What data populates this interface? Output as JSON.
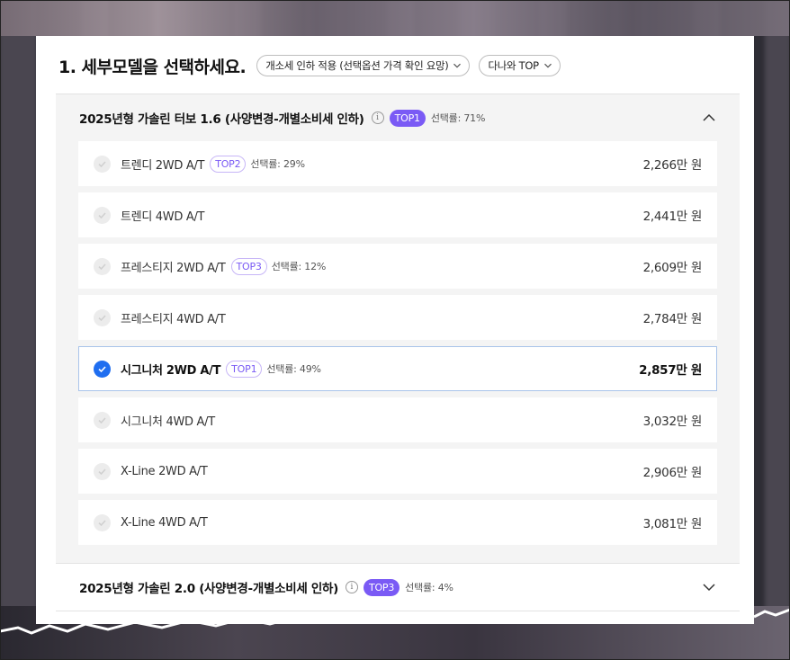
{
  "section": {
    "title": "1. 세부모델을 선택하세요.",
    "filter_label": "개소세 인하 적용 (선택옵션 가격 확인 요망)",
    "sort_label": "다나와 TOP"
  },
  "groups": [
    {
      "title": "2025년형 가솔린 터보 1.6 (사양변경-개별소비세 인하)",
      "badge": "TOP1",
      "rate": "선택률: 71%",
      "expanded": true,
      "items": [
        {
          "name": "트렌디 2WD A/T",
          "badge": "TOP2",
          "rate": "선택률: 29%",
          "price": "2,266만 원",
          "selected": false
        },
        {
          "name": "트렌디 4WD A/T",
          "badge": "",
          "rate": "",
          "price": "2,441만 원",
          "selected": false
        },
        {
          "name": "프레스티지 2WD A/T",
          "badge": "TOP3",
          "rate": "선택률: 12%",
          "price": "2,609만 원",
          "selected": false
        },
        {
          "name": "프레스티지 4WD A/T",
          "badge": "",
          "rate": "",
          "price": "2,784만 원",
          "selected": false
        },
        {
          "name": "시그니처 2WD A/T",
          "badge": "TOP1",
          "rate": "선택률: 49%",
          "price": "2,857만 원",
          "selected": true
        },
        {
          "name": "시그니처 4WD A/T",
          "badge": "",
          "rate": "",
          "price": "3,032만 원",
          "selected": false
        },
        {
          "name": "X-Line 2WD A/T",
          "badge": "",
          "rate": "",
          "price": "2,906만 원",
          "selected": false
        },
        {
          "name": "X-Line 4WD A/T",
          "badge": "",
          "rate": "",
          "price": "3,081만 원",
          "selected": false
        }
      ]
    },
    {
      "title": "2025년형 가솔린 2.0 (사양변경-개별소비세 인하)",
      "badge": "TOP3",
      "rate": "선택률: 4%",
      "expanded": false
    }
  ],
  "colors": {
    "accent_purple": "#7a5af5",
    "check_blue": "#1f6ef0",
    "selected_border": "#a9c4ea"
  },
  "icons": {
    "dropdown": "chevron-down-icon",
    "collapse": "chevron-up-icon",
    "expand": "chevron-down-icon",
    "info": "info-icon",
    "check": "check-icon"
  }
}
